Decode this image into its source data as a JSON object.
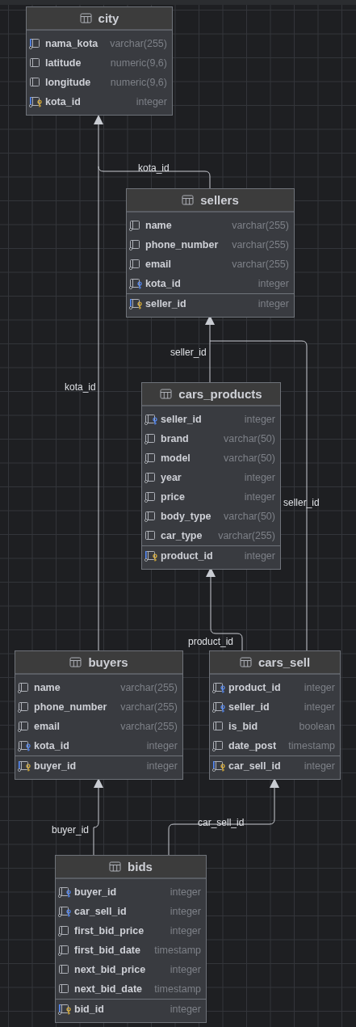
{
  "tables": [
    {
      "name": "city",
      "columns": [
        {
          "name": "nama_kota",
          "type": "varchar(255)",
          "kind": "indexed"
        },
        {
          "name": "latitude",
          "type": "numeric(9,6)",
          "kind": "column"
        },
        {
          "name": "longitude",
          "type": "numeric(9,6)",
          "kind": "column"
        },
        {
          "name": "kota_id",
          "type": "integer",
          "kind": "primary_key"
        }
      ]
    },
    {
      "name": "sellers",
      "columns": [
        {
          "name": "name",
          "type": "varchar(255)",
          "kind": "not_null"
        },
        {
          "name": "phone_number",
          "type": "varchar(255)",
          "kind": "not_null"
        },
        {
          "name": "email",
          "type": "varchar(255)",
          "kind": "not_null"
        },
        {
          "name": "kota_id",
          "type": "integer",
          "kind": "foreign_key"
        }
      ],
      "key_columns": [
        {
          "name": "seller_id",
          "type": "integer",
          "kind": "primary_key"
        }
      ]
    },
    {
      "name": "cars_products",
      "columns": [
        {
          "name": "seller_id",
          "type": "integer",
          "kind": "foreign_key"
        },
        {
          "name": "brand",
          "type": "varchar(50)",
          "kind": "not_null"
        },
        {
          "name": "model",
          "type": "varchar(50)",
          "kind": "not_null"
        },
        {
          "name": "year",
          "type": "integer",
          "kind": "not_null"
        },
        {
          "name": "price",
          "type": "integer",
          "kind": "not_null"
        },
        {
          "name": "body_type",
          "type": "varchar(50)",
          "kind": "not_null"
        },
        {
          "name": "car_type",
          "type": "varchar(255)",
          "kind": "column"
        }
      ],
      "key_columns": [
        {
          "name": "product_id",
          "type": "integer",
          "kind": "primary_key"
        }
      ]
    },
    {
      "name": "buyers",
      "columns": [
        {
          "name": "name",
          "type": "varchar(255)",
          "kind": "not_null"
        },
        {
          "name": "phone_number",
          "type": "varchar(255)",
          "kind": "not_null"
        },
        {
          "name": "email",
          "type": "varchar(255)",
          "kind": "not_null"
        },
        {
          "name": "kota_id",
          "type": "integer",
          "kind": "foreign_key"
        }
      ],
      "key_columns": [
        {
          "name": "buyer_id",
          "type": "integer",
          "kind": "primary_key"
        }
      ]
    },
    {
      "name": "cars_sell",
      "columns": [
        {
          "name": "product_id",
          "type": "integer",
          "kind": "foreign_key"
        },
        {
          "name": "seller_id",
          "type": "integer",
          "kind": "foreign_key"
        },
        {
          "name": "is_bid",
          "type": "boolean",
          "kind": "column"
        },
        {
          "name": "date_post",
          "type": "timestamp",
          "kind": "not_null"
        }
      ],
      "key_columns": [
        {
          "name": "car_sell_id",
          "type": "integer",
          "kind": "primary_key"
        }
      ]
    },
    {
      "name": "bids",
      "columns": [
        {
          "name": "buyer_id",
          "type": "integer",
          "kind": "foreign_key"
        },
        {
          "name": "car_sell_id",
          "type": "integer",
          "kind": "foreign_key"
        },
        {
          "name": "first_bid_price",
          "type": "integer",
          "kind": "not_null"
        },
        {
          "name": "first_bid_date",
          "type": "timestamp",
          "kind": "not_null"
        },
        {
          "name": "next_bid_price",
          "type": "integer",
          "kind": "column"
        },
        {
          "name": "next_bid_date",
          "type": "timestamp",
          "kind": "column"
        }
      ],
      "key_columns": [
        {
          "name": "bid_id",
          "type": "integer",
          "kind": "primary_key"
        }
      ]
    }
  ],
  "relations": [
    {
      "label": "kota_id"
    },
    {
      "label": "kota_id"
    },
    {
      "label": "seller_id"
    },
    {
      "label": "seller_id"
    },
    {
      "label": "product_id"
    },
    {
      "label": "buyer_id"
    },
    {
      "label": "car_sell_id"
    }
  ]
}
